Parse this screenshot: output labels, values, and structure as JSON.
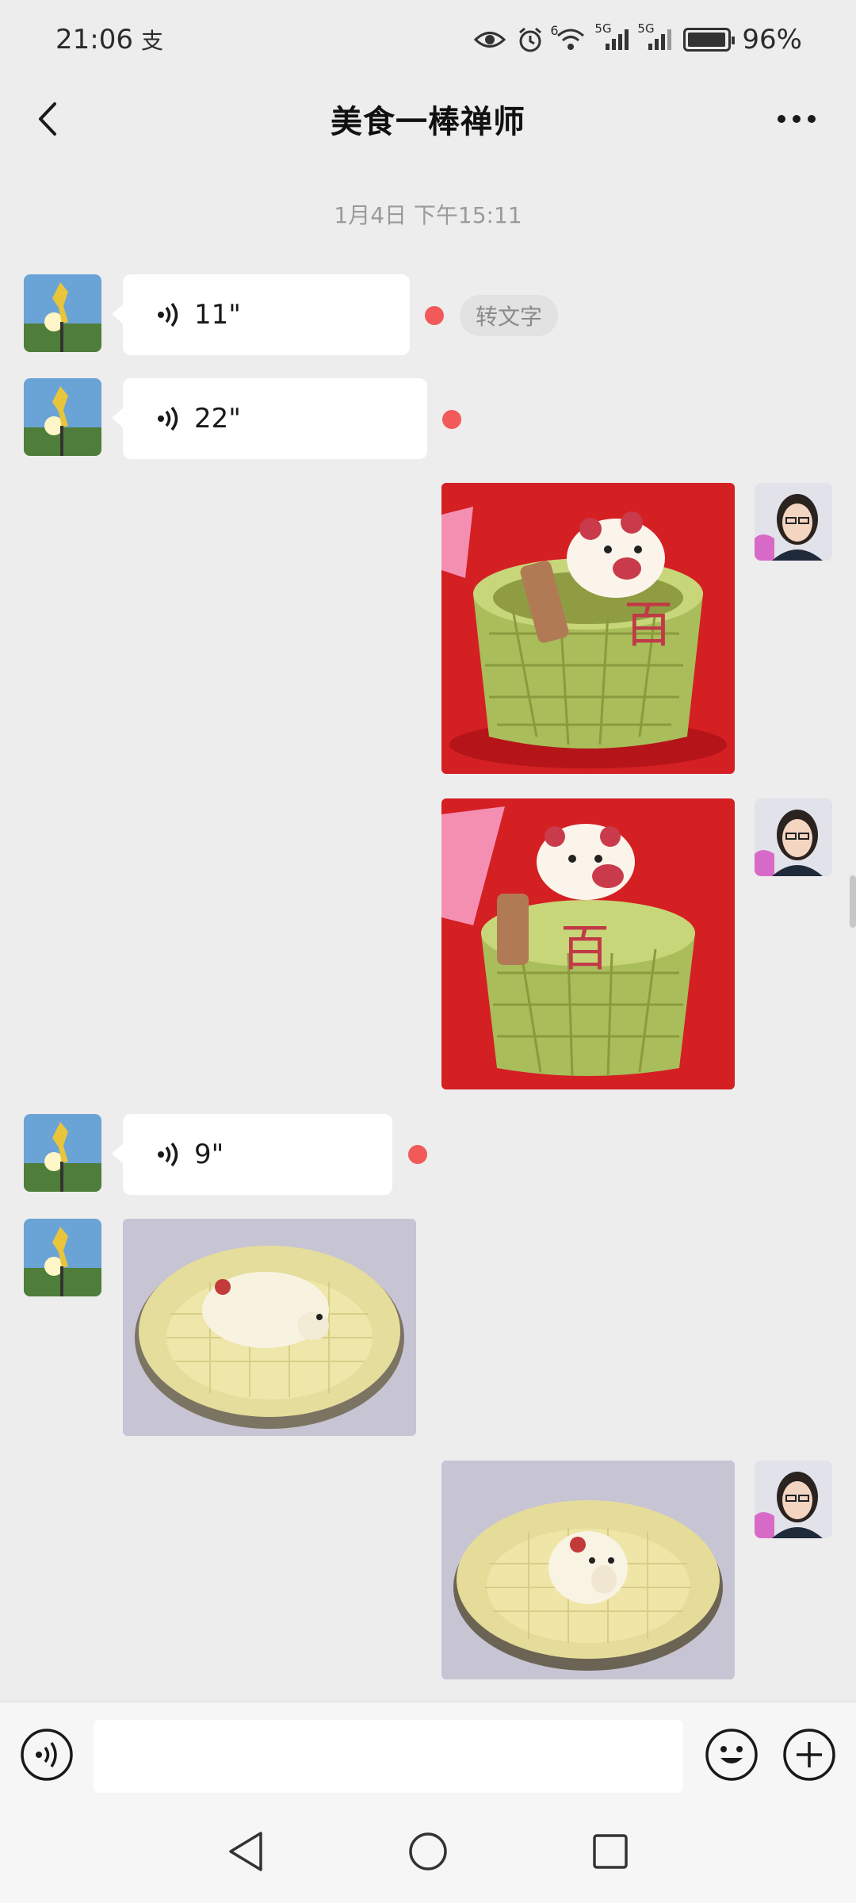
{
  "status_bar": {
    "time": "21:06",
    "notification_glyph": "支",
    "wifi_badge": "6",
    "signal_badge_1": "5G",
    "signal_badge_2": "5G",
    "battery_text": "96%",
    "battery_level": 0.96
  },
  "header": {
    "title": "美食一棒禅师"
  },
  "chat": {
    "timestamp": "1月4日 下午15:11",
    "voice_messages": [
      {
        "duration": "11\"",
        "transcribe_label": "转文字"
      },
      {
        "duration": "22\""
      },
      {
        "duration": "9\""
      }
    ]
  },
  "colors": {
    "background": "#ededed",
    "bubble": "#ffffff",
    "unread": "#f25a5a"
  },
  "icons": {
    "back": "chevron-left-icon",
    "more": "more-dots-icon",
    "voice": "voice-wave-icon",
    "emoji": "emoji-icon",
    "add": "plus-circle-icon"
  }
}
